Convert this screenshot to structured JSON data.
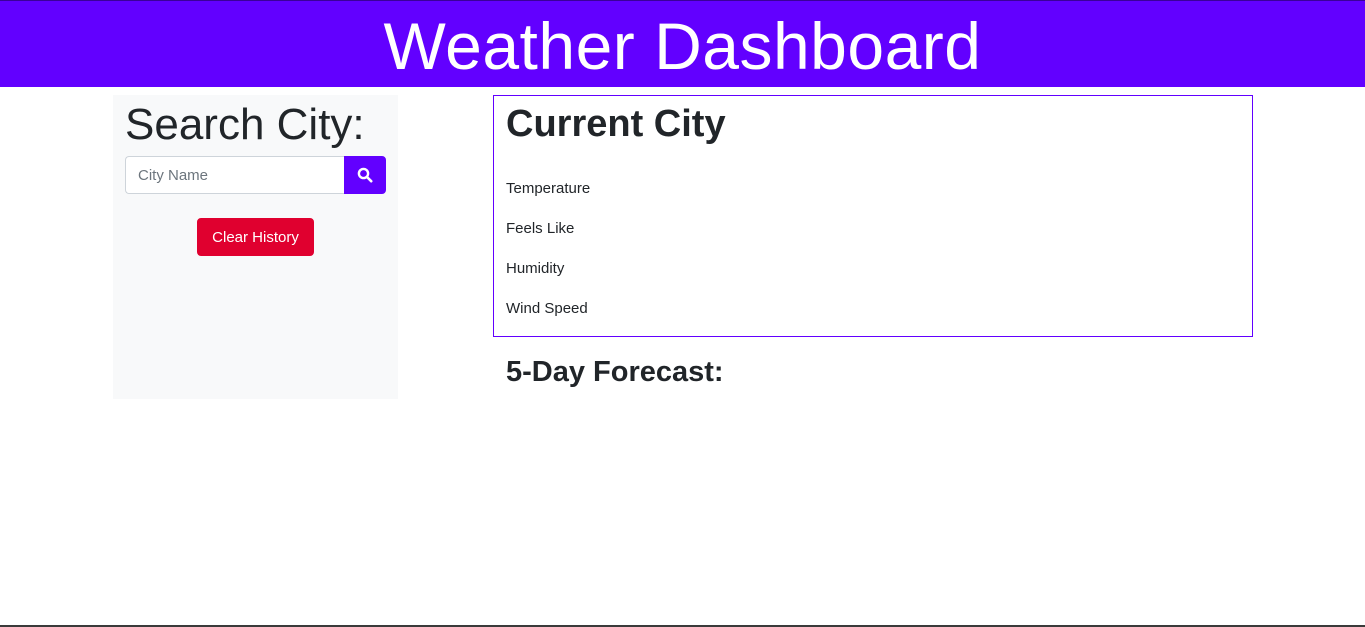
{
  "header": {
    "title": "Weather Dashboard"
  },
  "sidebar": {
    "heading": "Search City:",
    "search_placeholder": "City Name",
    "search_icon": "search-icon",
    "clear_label": "Clear History"
  },
  "current": {
    "title": "Current City",
    "metrics": [
      "Temperature",
      "Feels Like",
      "Humidity",
      "Wind Speed"
    ]
  },
  "forecast": {
    "title": "5-Day Forecast:"
  },
  "colors": {
    "brand": "#6200ff",
    "danger": "#e0002f",
    "sidebar_bg": "#f8f9fa"
  }
}
